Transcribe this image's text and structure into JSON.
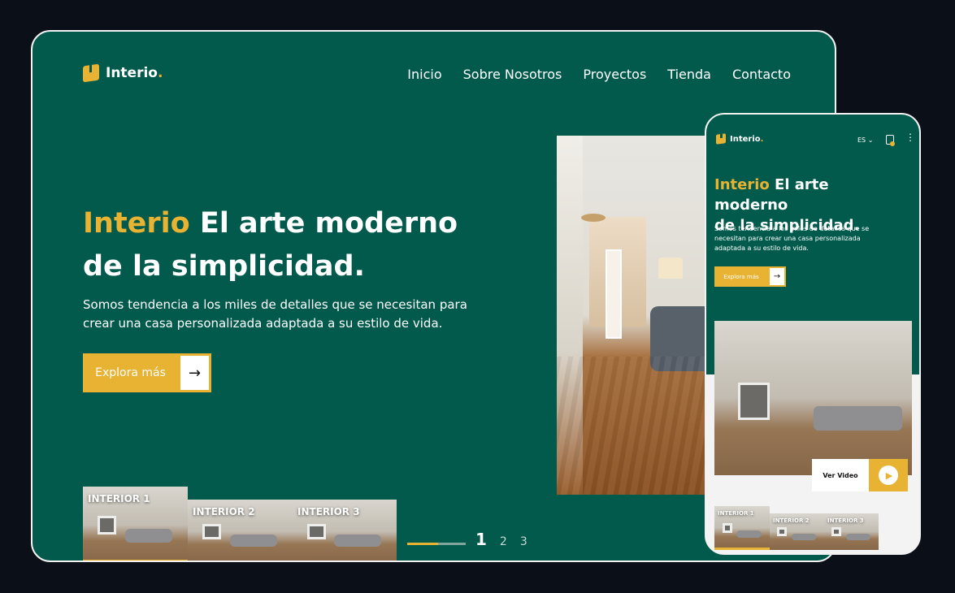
{
  "brand": {
    "name": "Interio",
    "dot": "."
  },
  "colors": {
    "primary": "#025a4c",
    "accent": "#e8b232",
    "background": "#0b0f17"
  },
  "desktop": {
    "nav": [
      "Inicio",
      "Sobre Nosotros",
      "Proyectos",
      "Tienda",
      "Contacto"
    ],
    "hero": {
      "title_accent": "Interio",
      "title_line1": "El arte moderno",
      "title_line2": "de la simplicidad.",
      "text": "Somos tendencia a los miles de detalles que se necesitan para crear una casa personalizada adaptada a su estilo de vida.",
      "cta_label": "Explora más",
      "cta_icon": "arrow-right-icon"
    },
    "thumbnails": [
      "INTERIOR 1",
      "INTERIOR 2",
      "INTERIOR 3"
    ],
    "pagination": {
      "current": "1",
      "pages": [
        "1",
        "2",
        "3"
      ]
    }
  },
  "mobile": {
    "language": "ES",
    "hero": {
      "title_accent": "Interio",
      "title_line1": "El arte moderno",
      "title_line2": "de la simplicidad.",
      "text": "Somos tendencia a los miles de detalles que se necesitan para crear una casa personalizada adaptada a su estilo de vida.",
      "cta_label": "Explora más"
    },
    "video_label": "Ver Video",
    "thumbnails": [
      "INTERIOR 1",
      "INTERIOR 2",
      "INTERIOR 3"
    ]
  }
}
